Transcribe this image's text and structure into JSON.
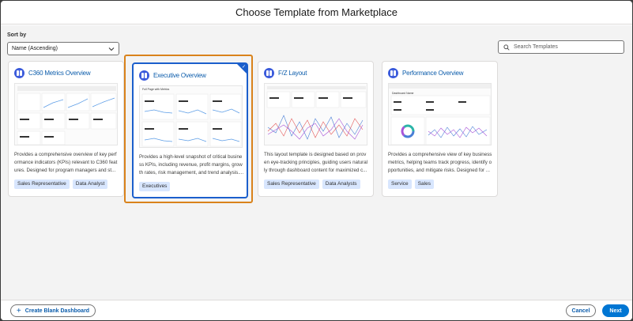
{
  "modal": {
    "title": "Choose Template from Marketplace"
  },
  "sort": {
    "label": "Sort by",
    "value": "Name (Ascending)"
  },
  "search": {
    "placeholder": "Search Templates"
  },
  "cards": [
    {
      "title": "C360 Metrics Overview",
      "description": "Provides a comprehensive overview of key perf ormance indicators (KPIs) relevant to C360 feat ures. Designed for program managers and st...",
      "tags": [
        "Sales Representative",
        "Data Analyst"
      ],
      "selected": false
    },
    {
      "title": "Executive Overview",
      "description": "Provides a high-level snapshot of critical busine ss KPIs, including revenue, profit margins, grow th rates, risk management, and trend analysis....",
      "tags": [
        "Executives"
      ],
      "selected": true,
      "thumb_title": "Full Page with Metrics"
    },
    {
      "title": "F/Z Layout",
      "description": "This layout template is designed based on prov en eye-tracking principles, guiding users natural ly through dashboard content for maximized c...",
      "tags": [
        "Sales Representative",
        "Data Analysts"
      ],
      "selected": false
    },
    {
      "title": "Performance Overview",
      "description": "Provides a comprehensive view of key business metrics, helping teams track progress, identify o pportunities, and mitigate risks. Designed for ...",
      "tags": [
        "Service",
        "Sales"
      ],
      "selected": false,
      "thumb_title": "Dashboard Name"
    }
  ],
  "footer": {
    "create_blank_label": "Create Blank Dashboard",
    "cancel_label": "Cancel",
    "next_label": "Next"
  },
  "colors": {
    "accent": "#0176d3",
    "title": "#0b5cab",
    "highlight": "#d9821b"
  }
}
